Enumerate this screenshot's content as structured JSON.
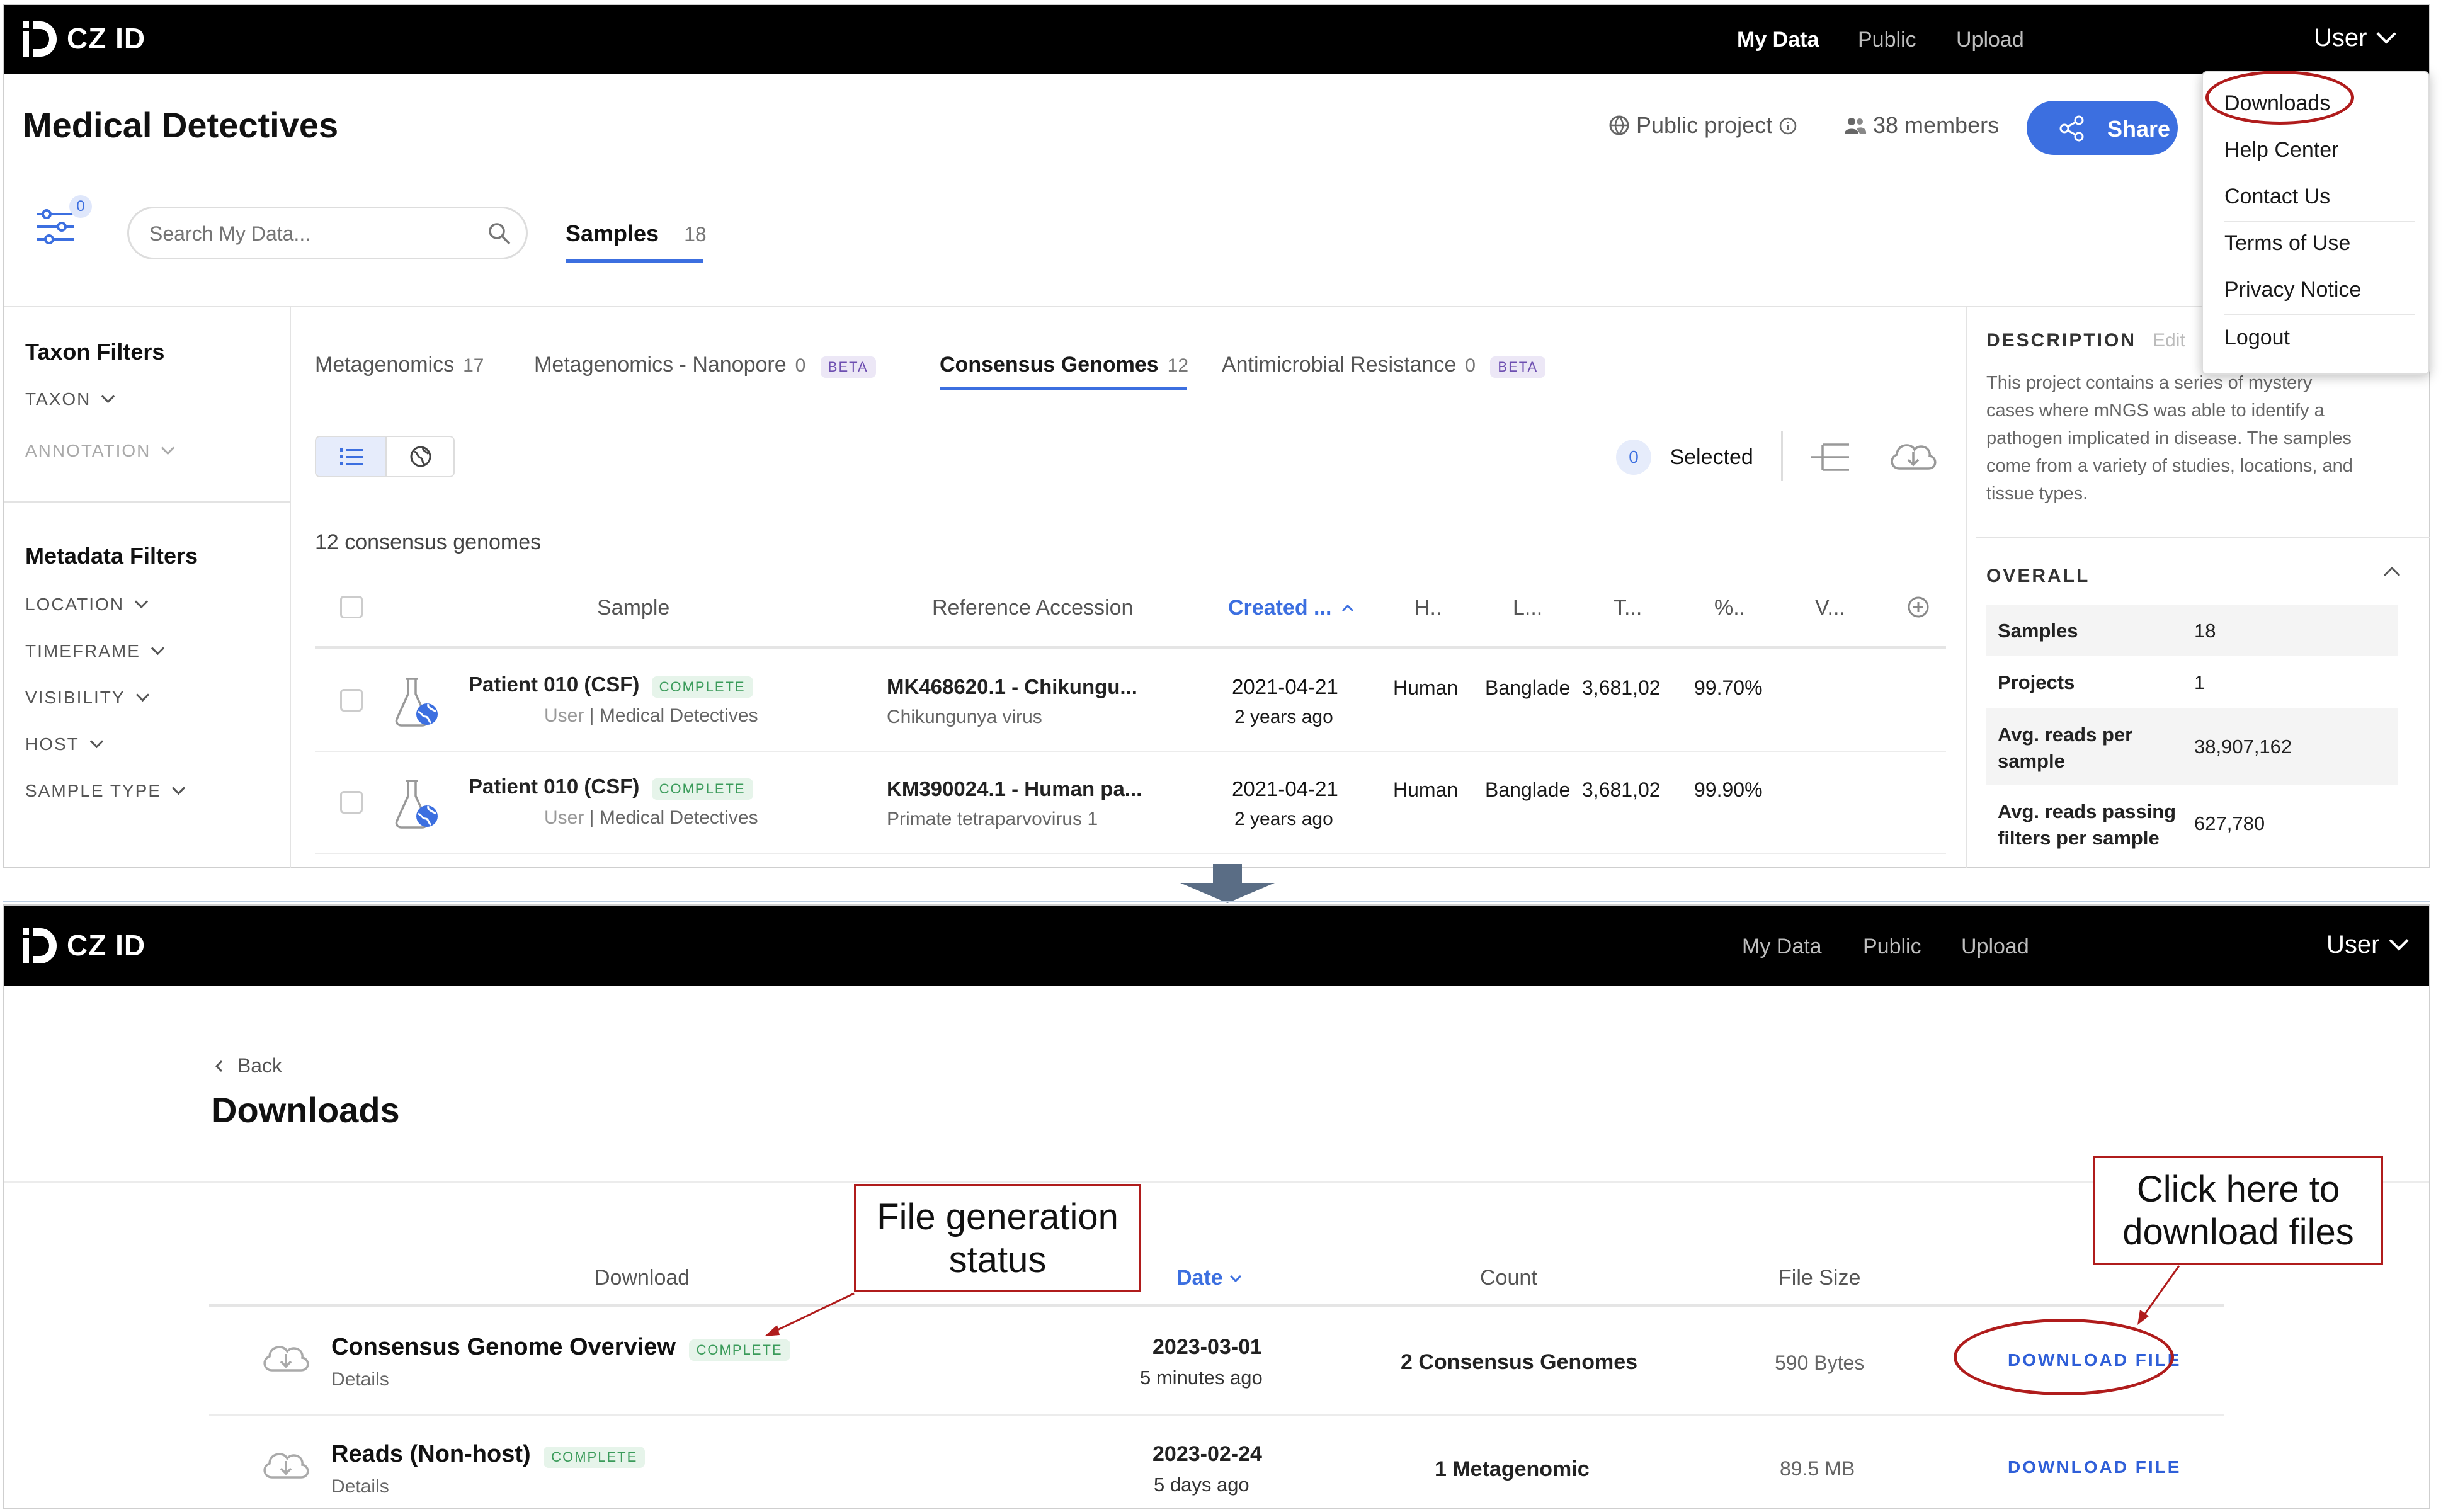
{
  "brand": {
    "logo_text": "CZ ID"
  },
  "screen1": {
    "nav": {
      "my_data": "My Data",
      "public": "Public",
      "upload": "Upload",
      "user": "User"
    },
    "project": {
      "title": "Medical Detectives",
      "visibility": "Public project",
      "members": "38 members",
      "share": "Share"
    },
    "filter_badge": "0",
    "search_placeholder": "Search My Data...",
    "samples_tab": {
      "label": "Samples",
      "count": "18"
    },
    "left_panel": {
      "taxon_title": "Taxon Filters",
      "taxon": "TAXON",
      "annotation": "ANNOTATION",
      "metadata_title": "Metadata Filters",
      "location": "LOCATION",
      "timeframe": "TIMEFRAME",
      "visibility": "VISIBILITY",
      "host": "HOST",
      "sample_type": "SAMPLE TYPE"
    },
    "workflow_tabs": [
      {
        "label": "Metagenomics",
        "count": "17",
        "badge": ""
      },
      {
        "label": "Metagenomics - Nanopore",
        "count": "0",
        "badge": "BETA"
      },
      {
        "label": "Consensus Genomes",
        "count": "12",
        "badge": ""
      },
      {
        "label": "Antimicrobial Resistance",
        "count": "0",
        "badge": "BETA"
      }
    ],
    "selected": {
      "count": "0",
      "label": "Selected"
    },
    "table_summary": "12 consensus genomes",
    "columns": [
      "Sample",
      "Reference Accession",
      "Created ...",
      "H..",
      "L...",
      "T...",
      "%..",
      "V..."
    ],
    "rows": [
      {
        "name": "Patient 010 (CSF)",
        "status": "COMPLETE",
        "owner": "User",
        "project": "Medical Detectives",
        "accession": "MK468620.1 - Chikungu...",
        "accession_sub": "Chikungunya virus",
        "date": "2021-04-21",
        "ago": "2 years ago",
        "host": "Human",
        "location": "Banglade",
        "total": "3,681,02",
        "pct": "99.70%"
      },
      {
        "name": "Patient 010 (CSF)",
        "status": "COMPLETE",
        "owner": "User",
        "project": "Medical Detectives",
        "accession": "KM390024.1 - Human pa...",
        "accession_sub": "Primate tetraparvovirus 1",
        "date": "2021-04-21",
        "ago": "2 years ago",
        "host": "Human",
        "location": "Banglade",
        "total": "3,681,02",
        "pct": "99.90%"
      }
    ],
    "description": {
      "title": "DESCRIPTION",
      "edit": "Edit",
      "text": "This project contains a series of mystery cases where mNGS was able to identify a pathogen implicated in disease. The samples come from a variety of studies, locations, and tissue types."
    },
    "overall": {
      "title": "OVERALL",
      "rows": [
        {
          "k": "Samples",
          "v": "18"
        },
        {
          "k": "Projects",
          "v": "1"
        },
        {
          "k": "Avg. reads per sample",
          "v": "38,907,162"
        },
        {
          "k": "Avg. reads passing filters per sample",
          "v": "627,780"
        }
      ]
    },
    "user_menu": [
      "Downloads",
      "Help Center",
      "Contact Us",
      "Terms of Use",
      "Privacy Notice",
      "Logout"
    ]
  },
  "screen2": {
    "nav": {
      "my_data": "My Data",
      "public": "Public",
      "upload": "Upload",
      "user": "User"
    },
    "back": "Back",
    "title": "Downloads",
    "columns": {
      "download": "Download",
      "date": "Date",
      "count": "Count",
      "file_size": "File Size"
    },
    "rows": [
      {
        "name": "Consensus Genome Overview",
        "status": "COMPLETE",
        "details": "Details",
        "date": "2023-03-01",
        "ago": "5 minutes ago",
        "count": "2 Consensus Genomes",
        "size": "590 Bytes",
        "action": "DOWNLOAD FILE"
      },
      {
        "name": "Reads (Non-host)",
        "status": "COMPLETE",
        "details": "Details",
        "date": "2023-02-24",
        "ago": "5 days ago",
        "count": "1 Metagenomic",
        "size": "89.5 MB",
        "action": "DOWNLOAD FILE"
      }
    ]
  },
  "annotations": {
    "file_status": "File generation status",
    "click_here": "Click here to download files"
  },
  "colors": {
    "accent": "#2f5fd8",
    "complete": "#3a9b5a",
    "beta": "#6e4fb1",
    "annotation": "#b01c1c"
  }
}
